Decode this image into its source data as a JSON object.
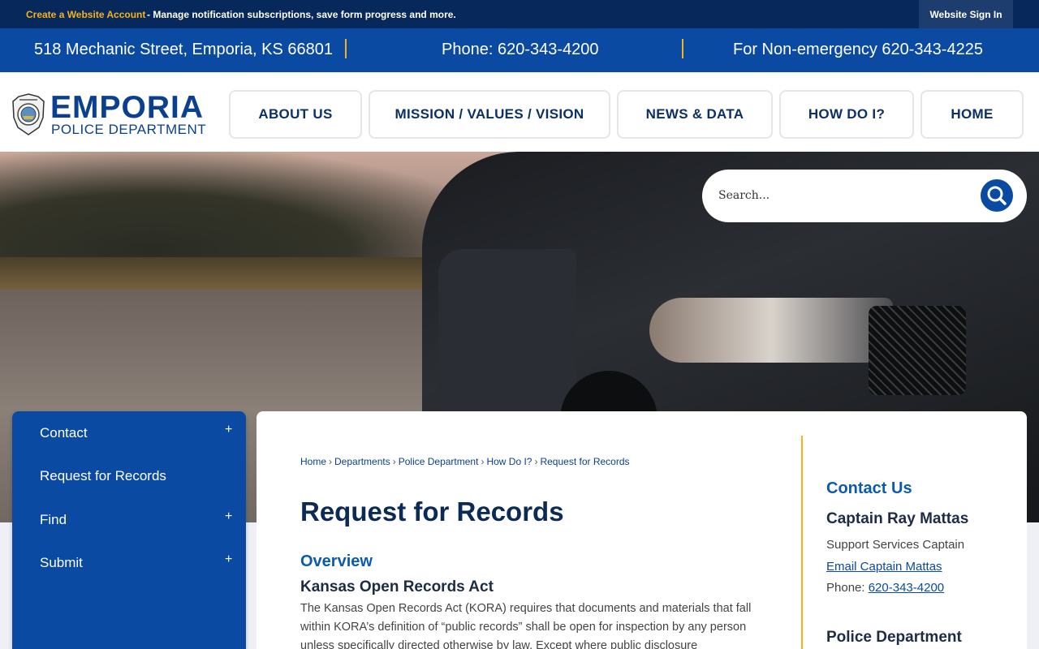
{
  "topbar": {
    "create_account": "Create a Website Account",
    "create_desc": "- Manage notification subscriptions, save form progress and more.",
    "sign_in": "Website Sign In"
  },
  "contactbar": {
    "address": "518 Mechanic Street, Emporia, KS 66801",
    "phone": "Phone: 620-343-4200",
    "nonemergency": "For Non-emergency 620-343-4225"
  },
  "logo": {
    "name": "EMPORIA",
    "dept": "POLICE DEPARTMENT"
  },
  "nav": {
    "about": "ABOUT US",
    "mission": "MISSION / VALUES / VISION",
    "news": "NEWS & DATA",
    "howdoi": "HOW DO I?",
    "home": "HOME"
  },
  "search": {
    "placeholder": "Search..."
  },
  "sidebar": {
    "items": [
      {
        "label": "Contact",
        "expand": "+"
      },
      {
        "label": "Request for Records",
        "expand": ""
      },
      {
        "label": "Find",
        "expand": "+"
      },
      {
        "label": "Submit",
        "expand": "+"
      }
    ]
  },
  "breadcrumb": [
    "Home",
    "Departments",
    "Police Department",
    "How Do I?",
    "Request for Records"
  ],
  "main": {
    "title": "Request for Records",
    "overview": "Overview",
    "subheading": "Kansas Open Records Act",
    "body": "The Kansas Open Records Act (KORA) requires that documents and materials that fall within KORA’s definition of “public records” shall be open for inspection by any person unless specifically directed otherwise by law. Except where public disclosure"
  },
  "contact": {
    "heading": "Contact Us",
    "name": "Captain Ray Mattas",
    "role": "Support Services Captain",
    "email": "Email Captain Mattas",
    "phone_label": "Phone: ",
    "phone": "620-343-4200",
    "dept_heading": "Police Department"
  },
  "colors": {
    "navy": "#07285a",
    "blue": "#0a4aa3",
    "gold": "#f5b21a"
  }
}
